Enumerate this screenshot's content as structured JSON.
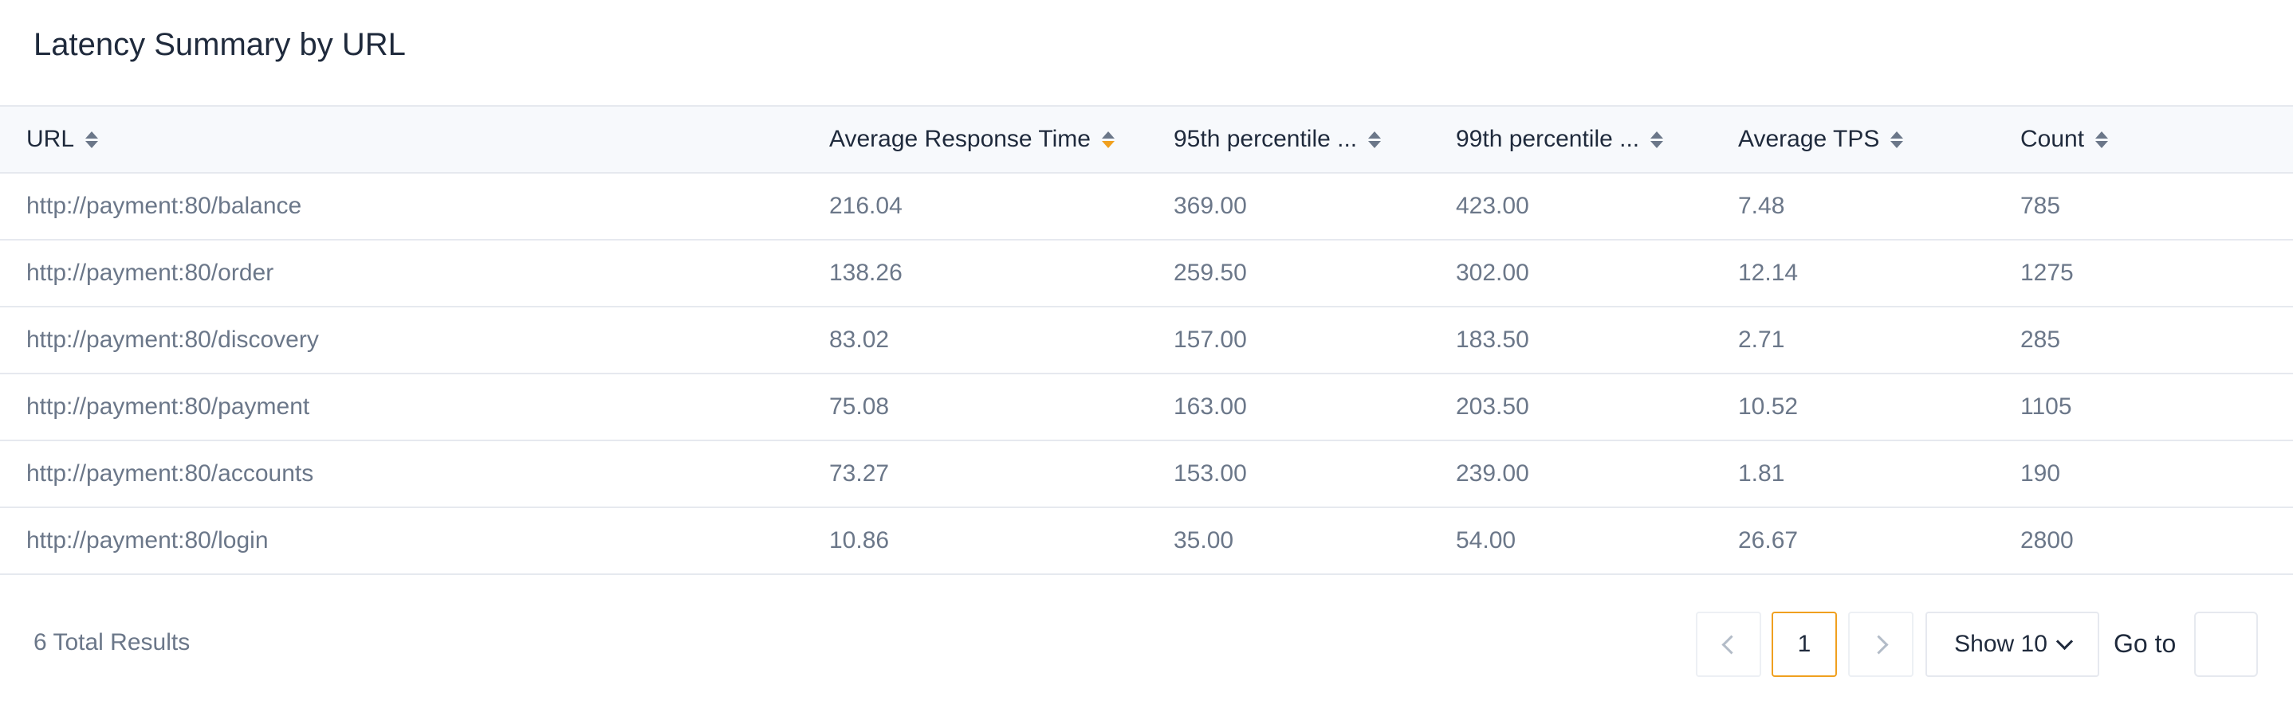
{
  "title": "Latency Summary by URL",
  "table": {
    "columns": [
      {
        "label": "URL",
        "sort": "none"
      },
      {
        "label": "Average Response Time",
        "sort": "desc"
      },
      {
        "label": "95th percentile ...",
        "sort": "none"
      },
      {
        "label": "99th percentile ...",
        "sort": "none"
      },
      {
        "label": "Average TPS",
        "sort": "none"
      },
      {
        "label": "Count",
        "sort": "none"
      }
    ],
    "rows": [
      [
        "http://payment:80/balance",
        "216.04",
        "369.00",
        "423.00",
        "7.48",
        "785"
      ],
      [
        "http://payment:80/order",
        "138.26",
        "259.50",
        "302.00",
        "12.14",
        "1275"
      ],
      [
        "http://payment:80/discovery",
        "83.02",
        "157.00",
        "183.50",
        "2.71",
        "285"
      ],
      [
        "http://payment:80/payment",
        "75.08",
        "163.00",
        "203.50",
        "10.52",
        "1105"
      ],
      [
        "http://payment:80/accounts",
        "73.27",
        "153.00",
        "239.00",
        "1.81",
        "190"
      ],
      [
        "http://payment:80/login",
        "10.86",
        "35.00",
        "54.00",
        "26.67",
        "2800"
      ]
    ]
  },
  "footer": {
    "total_results": "6 Total Results",
    "current_page": "1",
    "page_size_label": "Show 10",
    "goto_label": "Go to",
    "goto_value": ""
  },
  "colors": {
    "accent": "#f0a01f",
    "header_bg": "#f7f9fc",
    "muted_text": "#6b7789",
    "border": "#e6e9ef"
  }
}
